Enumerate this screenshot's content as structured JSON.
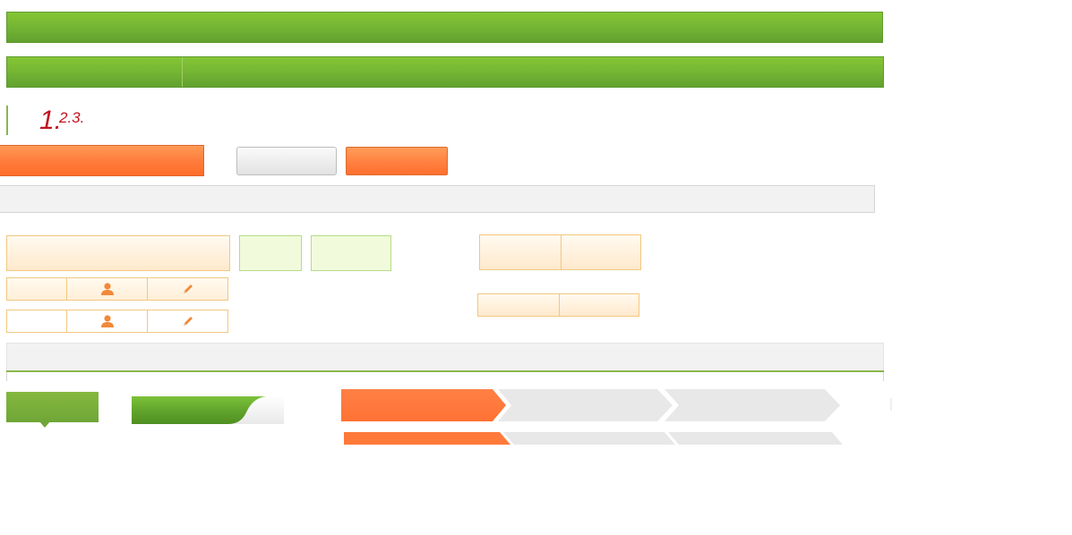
{
  "colors": {
    "green": "#76b534",
    "orange": "#ff7a3a",
    "red_text": "#c0121f",
    "cream": "#ffefd8",
    "step_gray": "#e8e8e8"
  },
  "step_indicator": {
    "current": "1.",
    "rest": "2.3."
  },
  "icons": {
    "user": "user-icon",
    "edit": "pencil-icon"
  },
  "progress_steps": [
    {
      "state": "active"
    },
    {
      "state": "inactive"
    },
    {
      "state": "inactive"
    }
  ]
}
